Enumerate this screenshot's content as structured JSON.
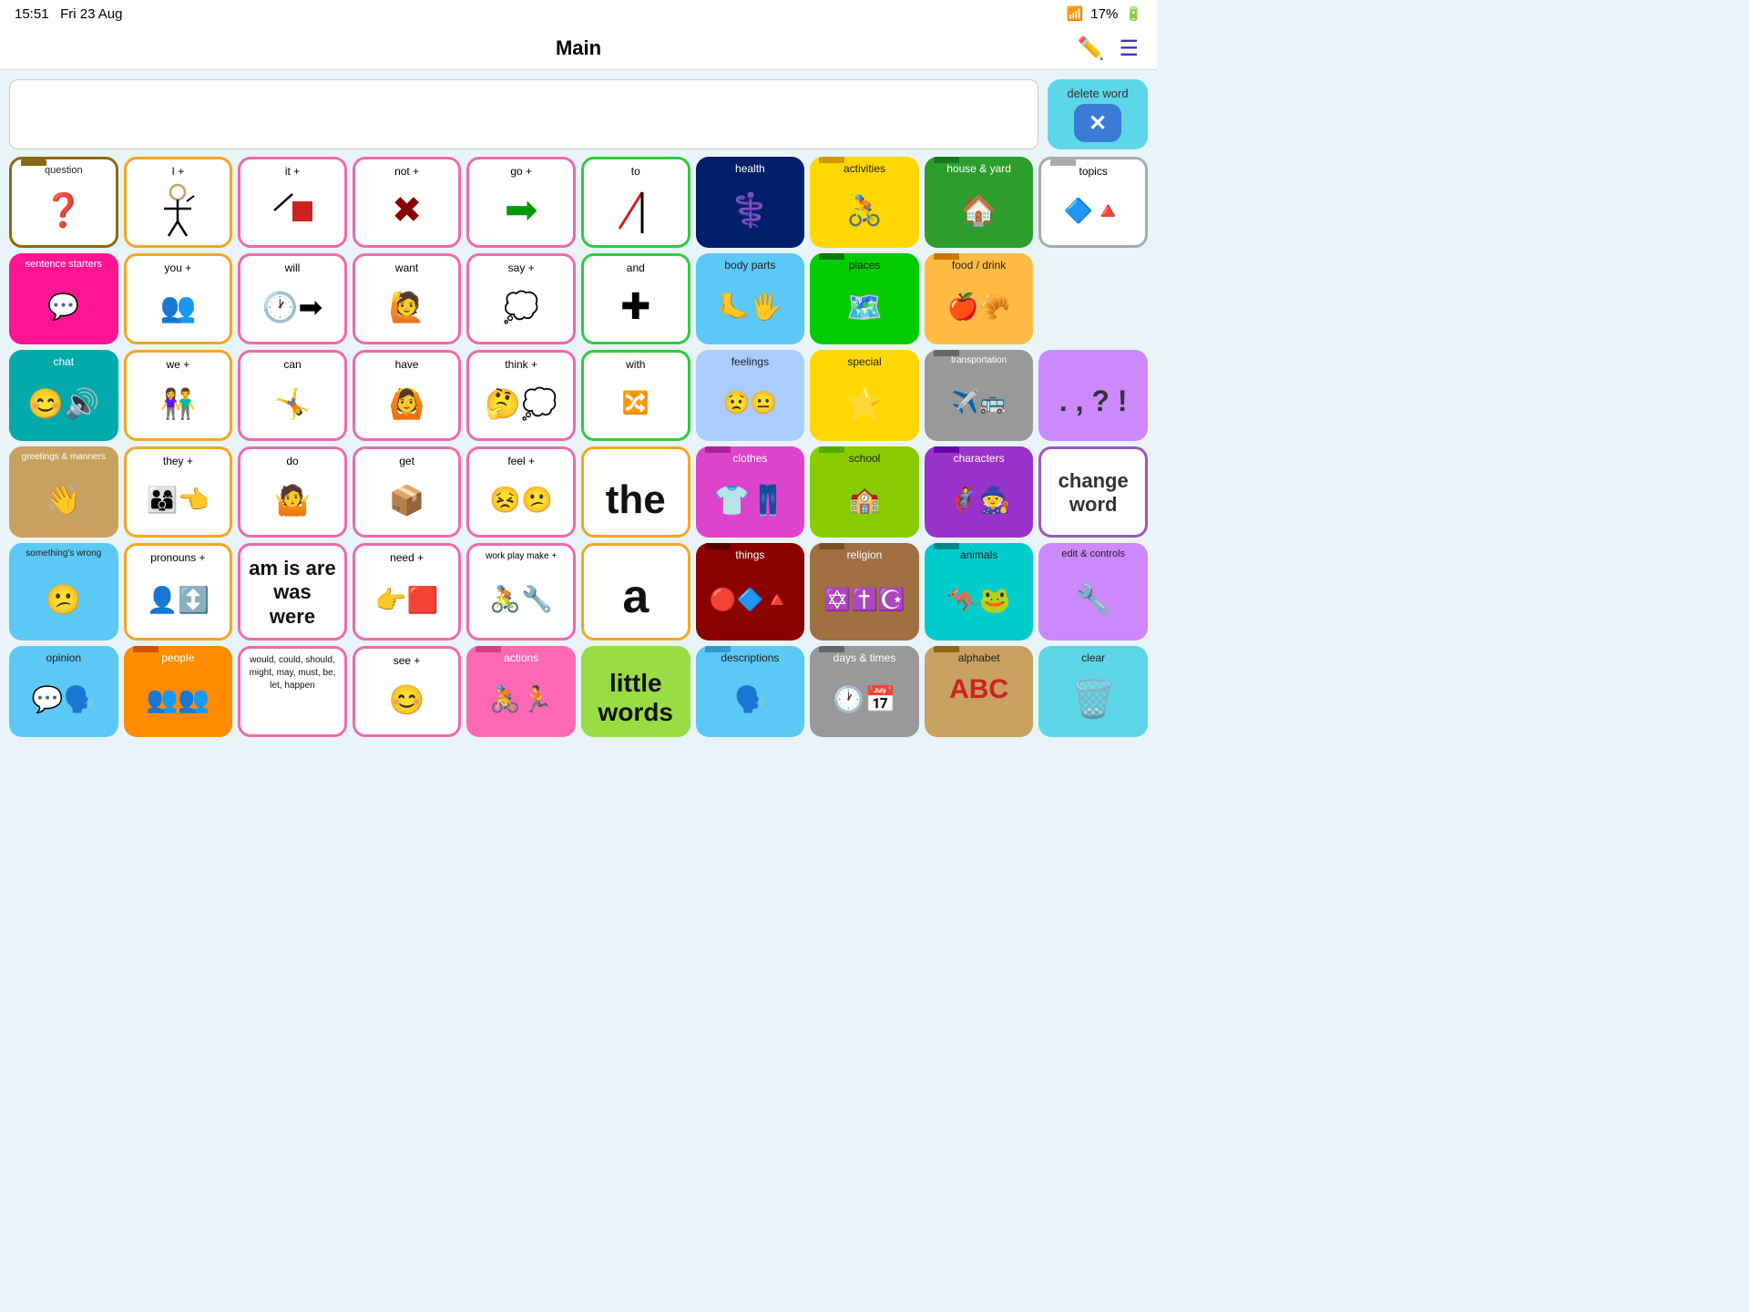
{
  "statusBar": {
    "time": "15:51",
    "date": "Fri 23 Aug",
    "battery": "17%"
  },
  "header": {
    "title": "Main",
    "editIcon": "✏️",
    "menuIcon": "☰"
  },
  "textArea": {
    "placeholder": "",
    "deleteWord": "delete word"
  },
  "grid": [
    [
      {
        "label": "question",
        "icon": "❓",
        "style": "border-brown folder-tab",
        "iconStyle": "text-3xl"
      },
      {
        "label": "I +",
        "icon": "🧍",
        "style": "border-orange",
        "iconStyle": ""
      },
      {
        "label": "it +",
        "icon": "🟥",
        "style": "border-pink",
        "iconStyle": ""
      },
      {
        "label": "not +",
        "icon": "✖️",
        "style": "border-pink",
        "iconStyle": ""
      },
      {
        "label": "go +",
        "icon": "➡️",
        "style": "border-pink",
        "iconStyle": ""
      },
      {
        "label": "to",
        "icon": "↗️",
        "style": "border-green",
        "iconStyle": ""
      },
      {
        "label": "health",
        "icon": "⚕️",
        "style": "bg-navy",
        "iconStyle": "cell-label-white"
      },
      {
        "label": "activities",
        "icon": "🚴",
        "style": "bg-yellow folder-tab",
        "iconStyle": "cell-label-dark"
      },
      {
        "label": "house & yard",
        "icon": "🏠",
        "style": "bg-green folder-tab",
        "iconStyle": "cell-label-white"
      },
      {
        "label": "topics",
        "icon": "🔷",
        "style": "border-gray folder-tab",
        "iconStyle": ""
      }
    ],
    [
      {
        "label": "sentence starters",
        "icon": "💬",
        "style": "bg-hot-pink",
        "iconStyle": "cell-label-white"
      },
      {
        "label": "you +",
        "icon": "👥",
        "style": "border-orange",
        "iconStyle": ""
      },
      {
        "label": "will",
        "icon": "🕐",
        "style": "border-pink",
        "iconStyle": ""
      },
      {
        "label": "want",
        "icon": "🙋",
        "style": "border-pink",
        "iconStyle": ""
      },
      {
        "label": "say +",
        "icon": "💭",
        "style": "border-pink",
        "iconStyle": ""
      },
      {
        "label": "and",
        "icon": "➕",
        "style": "border-green",
        "iconStyle": ""
      },
      {
        "label": "body parts",
        "icon": "🦶",
        "style": "bg-light-blue",
        "iconStyle": "cell-label-dark"
      },
      {
        "label": "places",
        "icon": "🗺️",
        "style": "bg-bright-green folder-tab",
        "iconStyle": "cell-label-dark"
      },
      {
        "label": "food / drink",
        "icon": "🍎",
        "style": "bg-light-orange folder-tab",
        "iconStyle": "cell-label-dark"
      }
    ],
    [
      {
        "label": "chat",
        "icon": "😊",
        "style": "bg-teal",
        "iconStyle": "cell-label-white"
      },
      {
        "label": "we +",
        "icon": "👫",
        "style": "border-orange",
        "iconStyle": ""
      },
      {
        "label": "can",
        "icon": "🤸",
        "style": "border-pink",
        "iconStyle": ""
      },
      {
        "label": "have",
        "icon": "🙆",
        "style": "border-pink",
        "iconStyle": ""
      },
      {
        "label": "think +",
        "icon": "🤔",
        "style": "border-pink",
        "iconStyle": ""
      },
      {
        "label": "with",
        "icon": "🔀",
        "style": "border-green",
        "iconStyle": ""
      },
      {
        "label": "feelings",
        "icon": "😟",
        "style": "bg-light-blue",
        "iconStyle": "cell-label-dark"
      },
      {
        "label": "special",
        "icon": "⭐",
        "style": "bg-yellow",
        "iconStyle": "cell-label-dark"
      },
      {
        "label": "transportation",
        "icon": "✈️",
        "style": "bg-gray-cell folder-tab",
        "iconStyle": "cell-label-white"
      },
      {
        "label": ". , ? !",
        "icon": "",
        "style": "bg-lavender",
        "iconStyle": ""
      }
    ],
    [
      {
        "label": "greetings & manners",
        "icon": "👋",
        "style": "bg-tan",
        "iconStyle": "cell-label-white"
      },
      {
        "label": "they +",
        "icon": "👨‍👩‍👦",
        "style": "border-orange",
        "iconStyle": ""
      },
      {
        "label": "do",
        "icon": "🤷",
        "style": "border-pink",
        "iconStyle": ""
      },
      {
        "label": "get",
        "icon": "📦",
        "style": "border-pink",
        "iconStyle": ""
      },
      {
        "label": "feel +",
        "icon": "😣",
        "style": "border-pink",
        "iconStyle": ""
      },
      {
        "label": "the",
        "icon": "",
        "style": "border-orange text-xl",
        "iconStyle": ""
      },
      {
        "label": "clothes",
        "icon": "👕",
        "style": "bg-magenta folder-tab",
        "iconStyle": "cell-label-white"
      },
      {
        "label": "school",
        "icon": "🏫",
        "style": "bg-lime folder-tab",
        "iconStyle": "cell-label-dark"
      },
      {
        "label": "characters",
        "icon": "🦸",
        "style": "bg-purple-cell folder-tab",
        "iconStyle": "cell-label-white"
      },
      {
        "label": "change word",
        "icon": "",
        "style": "border-purple",
        "iconStyle": ""
      }
    ],
    [
      {
        "label": "something's wrong",
        "icon": "😕",
        "style": "bg-light-blue",
        "iconStyle": "cell-label-dark"
      },
      {
        "label": "pronouns +",
        "icon": "👤",
        "style": "border-orange",
        "iconStyle": ""
      },
      {
        "label": "am is are was were",
        "icon": "",
        "style": "border-pink text-xl",
        "iconStyle": ""
      },
      {
        "label": "need +",
        "icon": "👉",
        "style": "border-pink",
        "iconStyle": ""
      },
      {
        "label": "work play make +",
        "icon": "🔧",
        "style": "border-pink",
        "iconStyle": ""
      },
      {
        "label": "a",
        "icon": "",
        "style": "border-orange text-xl",
        "iconStyle": ""
      },
      {
        "label": "things",
        "icon": "🔺",
        "style": "bg-dark-red folder-tab",
        "iconStyle": "cell-label-white"
      },
      {
        "label": "religion",
        "icon": "✡️",
        "style": "bg-brown-cell folder-tab",
        "iconStyle": "cell-label-white"
      },
      {
        "label": "animals",
        "icon": "🦘",
        "style": "bg-cyan folder-tab",
        "iconStyle": "cell-label-dark"
      },
      {
        "label": "edit & controls",
        "icon": "🔧",
        "style": "bg-lavender",
        "iconStyle": "cell-label-dark"
      }
    ],
    [
      {
        "label": "opinion",
        "icon": "💬",
        "style": "bg-light-blue",
        "iconStyle": "cell-label-dark"
      },
      {
        "label": "people",
        "icon": "👥",
        "style": "bg-orange folder-tab",
        "iconStyle": "cell-label-white"
      },
      {
        "label": "would, could, should, might, may, must, be, let, happen",
        "icon": "",
        "style": "border-pink small-text",
        "iconStyle": ""
      },
      {
        "label": "see +",
        "icon": "😊",
        "style": "border-pink",
        "iconStyle": ""
      },
      {
        "label": "actions",
        "icon": "🚴",
        "style": "bg-pink folder-tab",
        "iconStyle": "cell-label-white"
      },
      {
        "label": "little words",
        "icon": "",
        "style": "bg-lime text-xl",
        "iconStyle": ""
      },
      {
        "label": "descriptions",
        "icon": "🗣️",
        "style": "bg-light-blue folder-tab",
        "iconStyle": "cell-label-dark"
      },
      {
        "label": "days & times",
        "icon": "🕐",
        "style": "bg-gray-cell folder-tab",
        "iconStyle": "cell-label-white"
      },
      {
        "label": "alphabet",
        "icon": "ABC",
        "style": "bg-tan folder-tab",
        "iconStyle": "cell-label-dark"
      },
      {
        "label": "clear",
        "icon": "🗑️",
        "style": "bg-cyan",
        "iconStyle": "cell-label-dark"
      }
    ]
  ]
}
